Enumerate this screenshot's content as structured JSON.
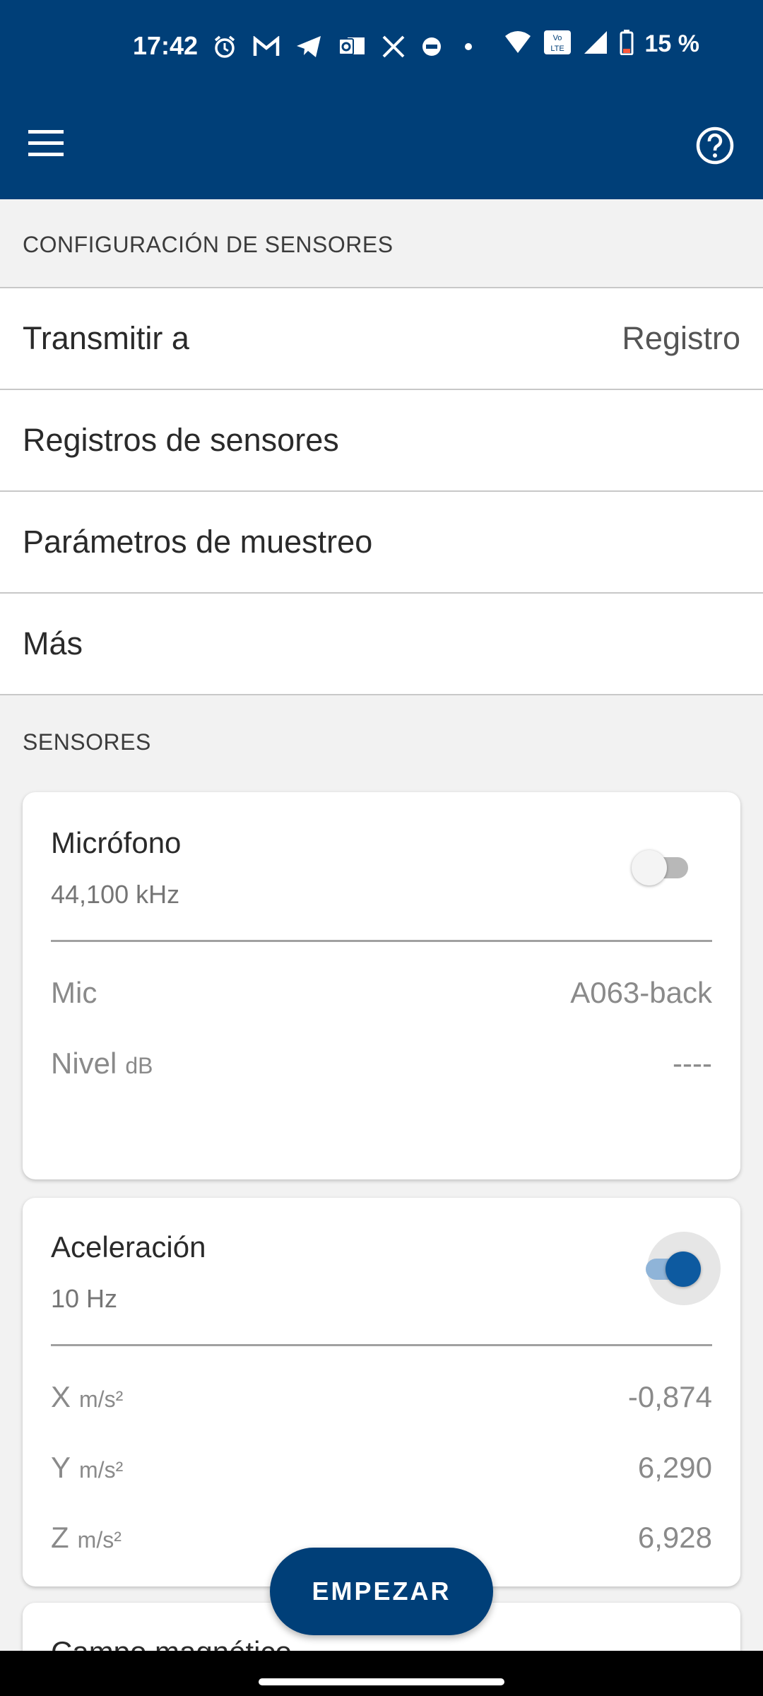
{
  "status_bar": {
    "time": "17:42",
    "battery": "15 %",
    "icons": [
      "alarm-icon",
      "gmail-icon",
      "telegram-icon",
      "outlook-icon",
      "x-icon",
      "wear-icon",
      "dot-icon",
      "wifi-icon",
      "volte-icon",
      "signal-icon",
      "battery-icon"
    ]
  },
  "app_bar": {
    "menu_icon": "menu-icon",
    "help_icon": "help-circle-icon"
  },
  "config_section": {
    "header": "CONFIGURACIÓN DE SENSORES",
    "rows": [
      {
        "label": "Transmitir a",
        "value": "Registro"
      },
      {
        "label": "Registros de sensores",
        "value": ""
      },
      {
        "label": "Parámetros de muestreo",
        "value": ""
      },
      {
        "label": "Más",
        "value": ""
      }
    ]
  },
  "sensors_section": {
    "header": "SENSORES",
    "microphone": {
      "title": "Micrófono",
      "rate": "44,100 kHz",
      "enabled": false,
      "mic_label": "Mic",
      "mic_value": "A063-back",
      "level_label": "Nivel",
      "level_unit": "dB",
      "level_value": "----"
    },
    "acceleration": {
      "title": "Aceleración",
      "rate": "10 Hz",
      "enabled": true,
      "axes": [
        {
          "label": "X",
          "unit": "m/s²",
          "value": "-0,874"
        },
        {
          "label": "Y",
          "unit": "m/s²",
          "value": "6,290"
        },
        {
          "label": "Z",
          "unit": "m/s²",
          "value": "6,928"
        }
      ]
    },
    "next_card_title": "Campo magnético"
  },
  "fab": {
    "label": "EMPEZAR"
  },
  "colors": {
    "primary": "#003f78",
    "toggle_on": "#0d5aa0",
    "toggle_on_track": "#8fb4d8"
  }
}
